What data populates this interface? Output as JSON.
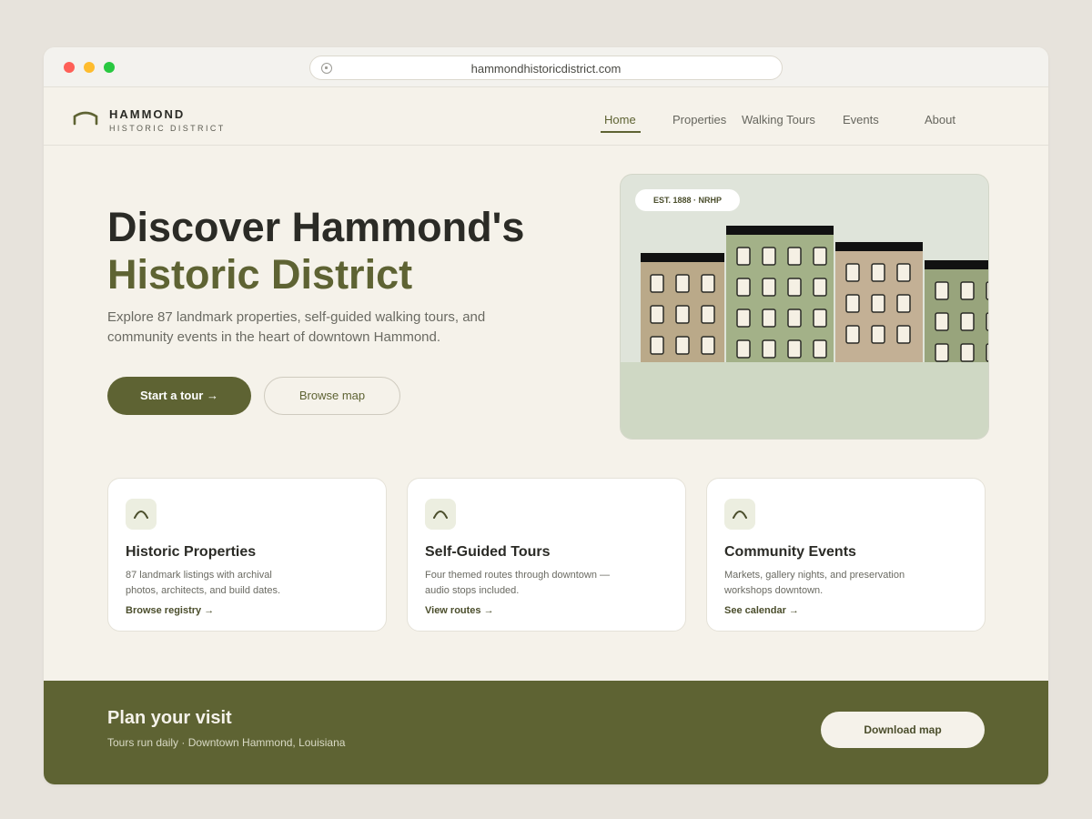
{
  "browser": {
    "url": "hammondhistoricdistrict.com",
    "icons": {
      "close": "red-dot",
      "minimize": "yellow-dot",
      "maximize": "green-dot",
      "lock": "lock-icon"
    }
  },
  "site": {
    "brand_name": "HAMMOND",
    "brand_sub": "HISTORIC DISTRICT",
    "logo_icon": "arch-icon",
    "nav": [
      {
        "label": "Home",
        "active": true
      },
      {
        "label": "Properties",
        "active": false
      },
      {
        "label": "Walking Tours",
        "active": false
      },
      {
        "label": "Events",
        "active": false
      },
      {
        "label": "About",
        "active": false
      }
    ]
  },
  "hero": {
    "title_line1": "Discover Hammond's",
    "title_line2": "Historic District",
    "description": "Explore 87 landmark properties, self-guided walking tours, and community events in the heart of downtown Hammond.",
    "primary_button": "Start a tour →",
    "secondary_button": "Browse map",
    "illustration_badge": "EST. 1888 · NRHP"
  },
  "cards": [
    {
      "title": "Historic Properties",
      "description": "87 landmark listings with archival photos, architects, and build dates.",
      "link": "Browse registry →",
      "icon": "arch-icon"
    },
    {
      "title": "Self-Guided Tours",
      "description": "Four themed routes through downtown — audio stops included.",
      "link": "View routes →",
      "icon": "arch-icon"
    },
    {
      "title": "Community Events",
      "description": "Markets, gallery nights, and preservation workshops downtown.",
      "link": "See calendar →",
      "icon": "arch-icon"
    }
  ],
  "cta": {
    "title": "Plan your visit",
    "subtitle": "Tours run daily · Downtown Hammond, Louisiana",
    "button": "Download map"
  },
  "colors": {
    "accent": "#5e6333",
    "page_bg": "#f5f2ea",
    "outer_bg": "#e7e3dc"
  }
}
